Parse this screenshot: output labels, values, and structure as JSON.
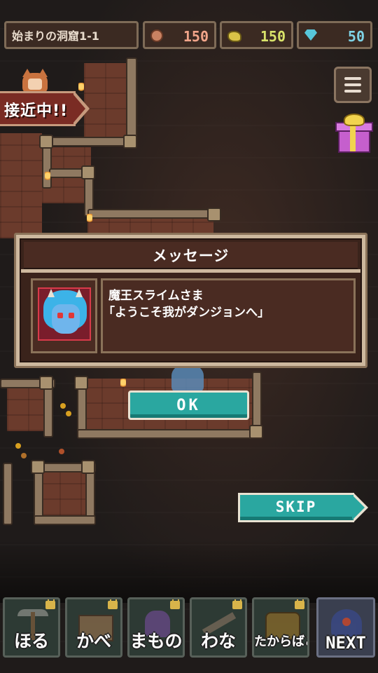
{
  "header": {
    "stage_name": "始まりの洞窟1-1",
    "resources": [
      {
        "name": "meat",
        "icon": "meat-icon",
        "value": "150",
        "color": "#f2a58a"
      },
      {
        "name": "gold",
        "icon": "gold-nugget-icon",
        "value": "150",
        "color": "#d9e36a"
      },
      {
        "name": "gem",
        "icon": "blue-gem-icon",
        "value": "50",
        "color": "#7fd3e6"
      }
    ]
  },
  "side": {
    "menu_icon": "hamburger-menu-icon",
    "gift_icon": "gift-box-icon"
  },
  "approach": {
    "label": "接近中!!"
  },
  "dialog": {
    "title": "メッセージ",
    "speaker": "魔王スライムさま",
    "message": "「ようこそ我がダンジョンへ」"
  },
  "buttons": {
    "ok": "OK",
    "skip": "SKIP"
  },
  "toolbar": {
    "items": [
      {
        "label": "ほる",
        "icon": "pickaxe-icon",
        "locked": true
      },
      {
        "label": "かべ",
        "icon": "wall-block-icon",
        "locked": true
      },
      {
        "label": "まもの",
        "icon": "monster-icon",
        "locked": true
      },
      {
        "label": "わな",
        "icon": "trap-icon",
        "locked": true
      },
      {
        "label": "たからばこ",
        "icon": "treasure-chest-icon",
        "locked": true
      },
      {
        "label": "NEXT",
        "icon": "next-portal-icon",
        "locked": false
      }
    ]
  },
  "colors": {
    "accent_teal": "#2aa7a0",
    "dialog_bg": "#3a231b",
    "frame": "#cdb89e"
  }
}
